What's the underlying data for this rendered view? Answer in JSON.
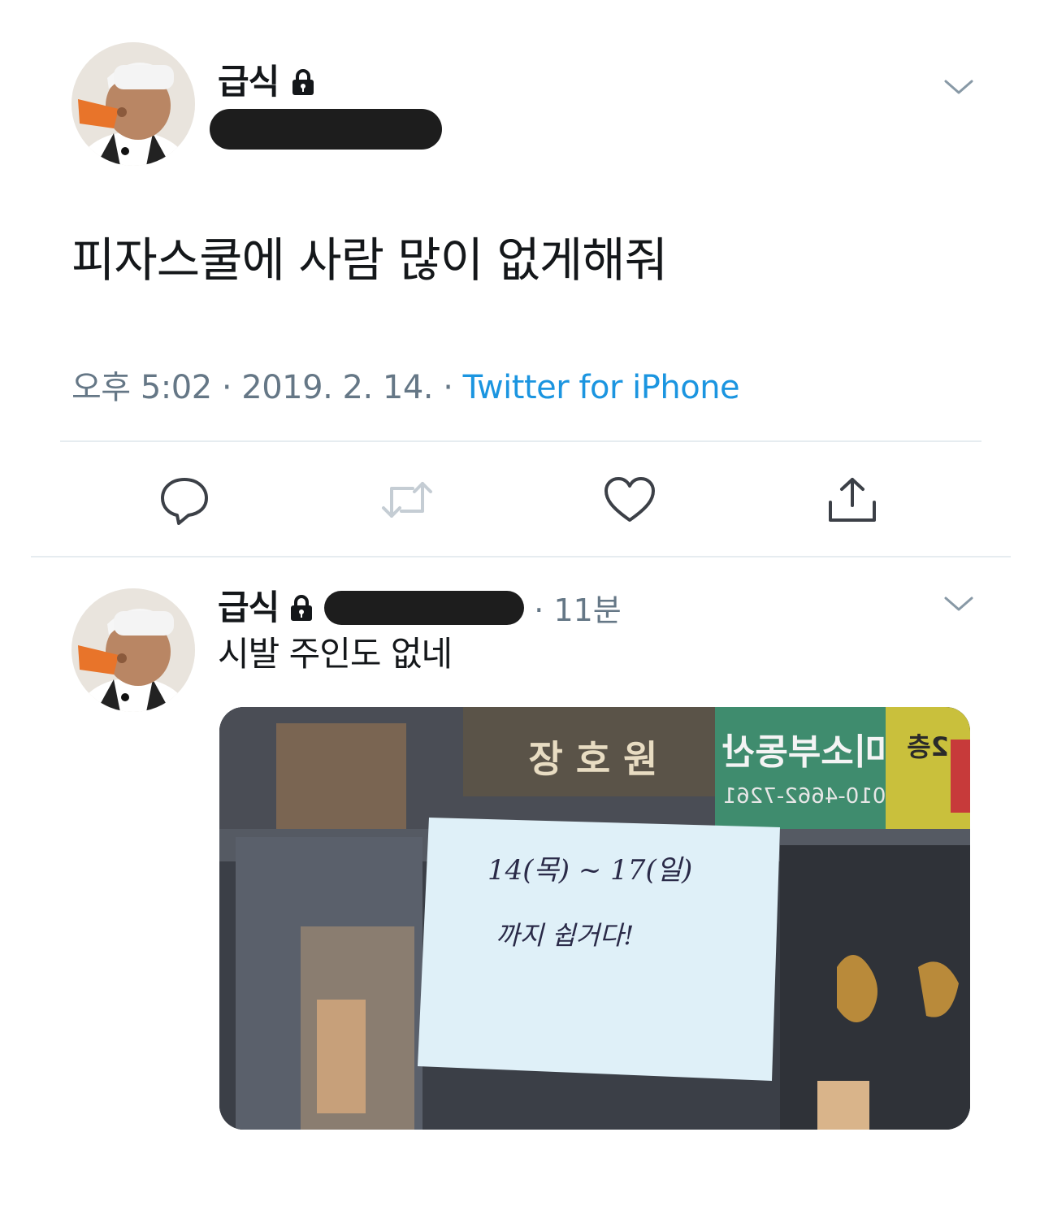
{
  "tweet": {
    "display_name": "급식",
    "text": "피자스쿨에 사람 많이 없게해줘",
    "meta_time": "오후 5:02 · 2019. 2. 14. · ",
    "meta_source": "Twitter for iPhone",
    "avatar_icon": "avatar-photo",
    "actions": [
      {
        "icon": "reply-icon"
      },
      {
        "icon": "retweet-icon",
        "disabled": true
      },
      {
        "icon": "like-icon"
      },
      {
        "icon": "share-icon"
      }
    ]
  },
  "reply": {
    "display_name": "급식",
    "time": "· 11분",
    "text": "시발 주인도 없네",
    "media": {
      "sign_line1": "14(목) ~ 17(일)",
      "sign_line2": "까지 쉽거다!",
      "store_sign": "미소부동산",
      "store_phone": "010-4662-7261",
      "floor_sign": "2층",
      "shop_sign": "장 호 원"
    }
  },
  "colors": {
    "link": "#1b95e0",
    "meta": "#657786",
    "redaction": "#1d1d1d",
    "divider": "#e6ecf0"
  }
}
